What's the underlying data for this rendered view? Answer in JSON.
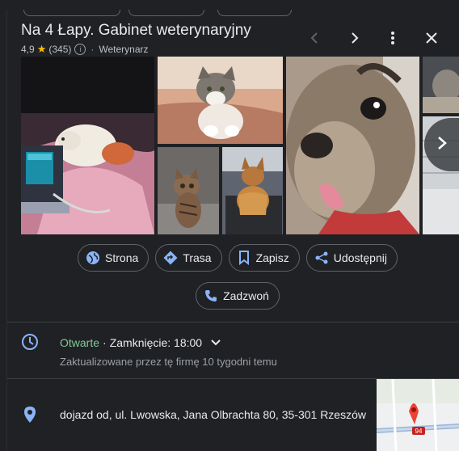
{
  "place": {
    "title": "Na 4 Łapy. Gabinet weterynaryjny",
    "rating": "4,9",
    "reviews": "(345)",
    "category": "Weterynarz"
  },
  "header_actions": [
    "chevron-left-icon",
    "chevron-right-icon",
    "more-vert-icon",
    "close-icon"
  ],
  "actions": {
    "website": "Strona",
    "route": "Trasa",
    "save": "Zapisz",
    "share": "Udostępnij",
    "call": "Zadzwoń"
  },
  "hours": {
    "status": "Otwarte",
    "closing": "Zamknięcie: 18:00",
    "updated": "Zaktualizowane przez tę firmę 10 tygodni temu"
  },
  "address": {
    "text": "dojazd od, ul. Lwowska, Jana Olbrachta 80, 35-301 Rzeszów",
    "map_road_label": "94"
  },
  "colors": {
    "background": "#202124",
    "accent_blue": "#8ab4f8",
    "open_green": "#81c995",
    "star": "#fbbc04",
    "pin_red": "#ea4335"
  }
}
